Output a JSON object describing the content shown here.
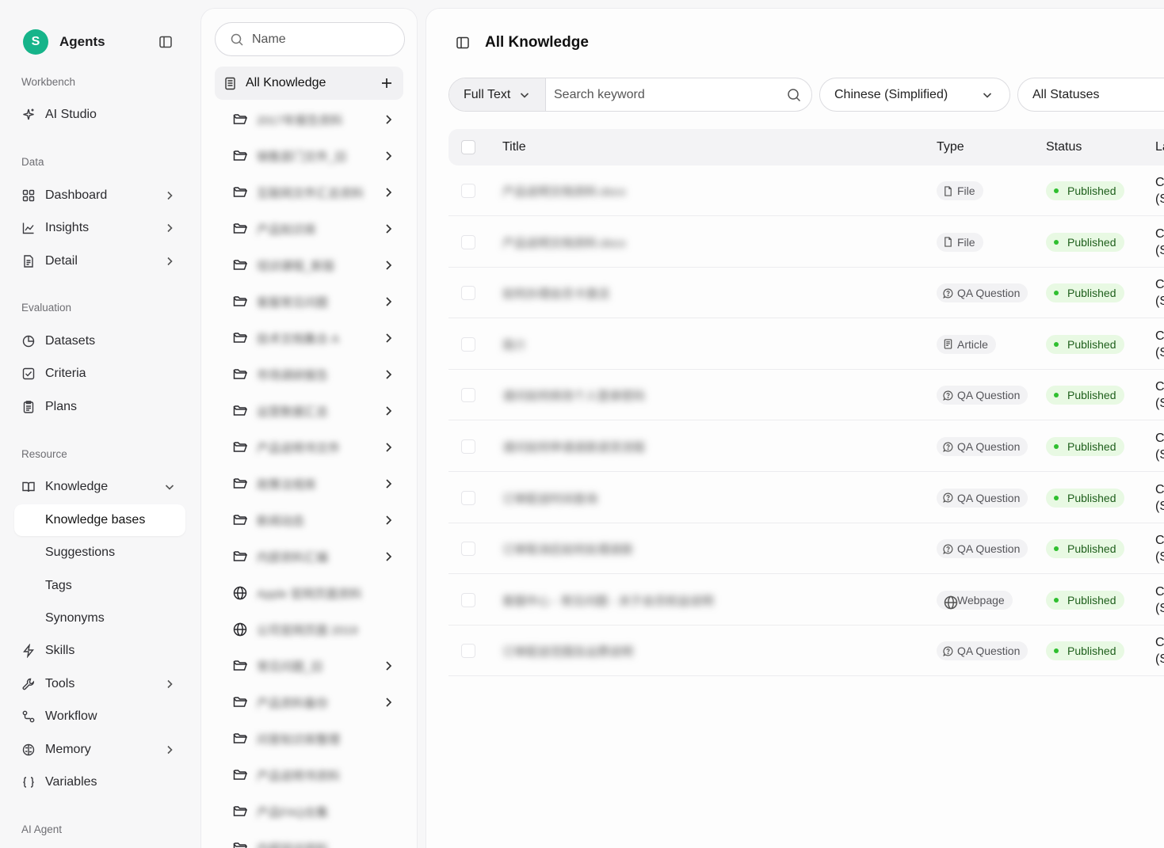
{
  "brand": {
    "initial": "S",
    "name": "Agents"
  },
  "nav": {
    "workbench_label": "Workbench",
    "ai_studio": "AI Studio",
    "data_label": "Data",
    "dashboard": "Dashboard",
    "insights": "Insights",
    "detail": "Detail",
    "evaluation_label": "Evaluation",
    "datasets": "Datasets",
    "criteria": "Criteria",
    "plans": "Plans",
    "resource_label": "Resource",
    "knowledge": "Knowledge",
    "knowledge_bases": "Knowledge bases",
    "suggestions": "Suggestions",
    "tags": "Tags",
    "synonyms": "Synonyms",
    "skills": "Skills",
    "tools": "Tools",
    "workflow": "Workflow",
    "memory": "Memory",
    "variables": "Variables",
    "ai_agent_label": "AI Agent"
  },
  "tree": {
    "search_placeholder": "Name",
    "root_label": "All Knowledge",
    "items": [
      {
        "icon": "folder-icon",
        "label": "2017年报告资料",
        "expandable": true
      },
      {
        "icon": "folder-icon",
        "label": "销售部门文件_旧",
        "expandable": true
      },
      {
        "icon": "folder-icon",
        "label": "互联网文件汇总资料",
        "expandable": true
      },
      {
        "icon": "folder-icon",
        "label": "产品知识库",
        "expandable": true
      },
      {
        "icon": "folder-icon",
        "label": "培训课程_新版",
        "expandable": true
      },
      {
        "icon": "folder-icon",
        "label": "客服常见问题",
        "expandable": true
      },
      {
        "icon": "folder-icon",
        "label": "技术文档集合 A",
        "expandable": true
      },
      {
        "icon": "folder-icon",
        "label": "市场调研报告",
        "expandable": true
      },
      {
        "icon": "folder-icon",
        "label": "运营数据汇总",
        "expandable": true
      },
      {
        "icon": "folder-icon",
        "label": "产品说明书文件",
        "expandable": true
      },
      {
        "icon": "folder-icon",
        "label": "政策法规库",
        "expandable": true
      },
      {
        "icon": "folder-icon",
        "label": "新闻动态",
        "expandable": true
      },
      {
        "icon": "folder-icon",
        "label": "内部资料汇编",
        "expandable": true
      },
      {
        "icon": "globe-icon",
        "label": "Apple 官网页面资料",
        "expandable": false
      },
      {
        "icon": "globe-icon",
        "label": "公司官网页面 2019",
        "expandable": false
      },
      {
        "icon": "folder-icon",
        "label": "常见问题_旧",
        "expandable": true
      },
      {
        "icon": "folder-icon",
        "label": "产品资料备份",
        "expandable": true
      },
      {
        "icon": "folder-icon",
        "label": "问答知识库整理",
        "expandable": false
      },
      {
        "icon": "folder-icon",
        "label": "产品说明书资料",
        "expandable": false
      },
      {
        "icon": "folder-icon",
        "label": "产品FAQ合集",
        "expandable": false
      },
      {
        "icon": "folder-icon",
        "label": "内部培训资料",
        "expandable": false
      }
    ]
  },
  "main": {
    "title": "All Knowledge",
    "search_mode": "Full Text",
    "search_placeholder": "Search keyword",
    "language": "Chinese (Simplified)",
    "status_filter": "All Statuses",
    "columns": {
      "title": "Title",
      "type": "Type",
      "status": "Status",
      "language": "La"
    },
    "rows": [
      {
        "title": "产品说明文档资料.docx",
        "type": "File",
        "type_icon": "file-icon",
        "status": "Published",
        "lang1": "C",
        "lang2": "(S"
      },
      {
        "title": "产品说明文档资料.docx",
        "type": "File",
        "type_icon": "file-icon",
        "status": "Published",
        "lang1": "C",
        "lang2": "(S"
      },
      {
        "title": "如何办理会员卡激活",
        "type": "QA Question",
        "type_icon": "qa-icon",
        "status": "Published",
        "lang1": "C",
        "lang2": "(S"
      },
      {
        "title": "简介",
        "type": "Article",
        "type_icon": "article-icon",
        "status": "Published",
        "lang1": "C",
        "lang2": "(S"
      },
      {
        "title": "请问如何修改个人登录密码",
        "type": "QA Question",
        "type_icon": "qa-icon",
        "status": "Published",
        "lang1": "C",
        "lang2": "(S"
      },
      {
        "title": "请问如何申请退款退货流程",
        "type": "QA Question",
        "type_icon": "qa-icon",
        "status": "Published",
        "lang1": "C",
        "lang2": "(S"
      },
      {
        "title": "订单配送时间查询",
        "type": "QA Question",
        "type_icon": "qa-icon",
        "status": "Published",
        "lang1": "C",
        "lang2": "(S"
      },
      {
        "title": "订单取消后如何处理退款",
        "type": "QA Question",
        "type_icon": "qa-icon",
        "status": "Published",
        "lang1": "C",
        "lang2": "(S"
      },
      {
        "title": "客服中心 - 常见问题 - 关于会员权益说明",
        "type": "Webpage",
        "type_icon": "globe-icon",
        "status": "Published",
        "lang1": "C",
        "lang2": "(S"
      },
      {
        "title": "订单配送范围及运费说明",
        "type": "QA Question",
        "type_icon": "qa-icon",
        "status": "Published",
        "lang1": "C",
        "lang2": "(S"
      }
    ]
  },
  "colors": {
    "brand": "#16b48a",
    "published_bg": "#e8f9e3",
    "published_dot": "#2fbf2f"
  }
}
